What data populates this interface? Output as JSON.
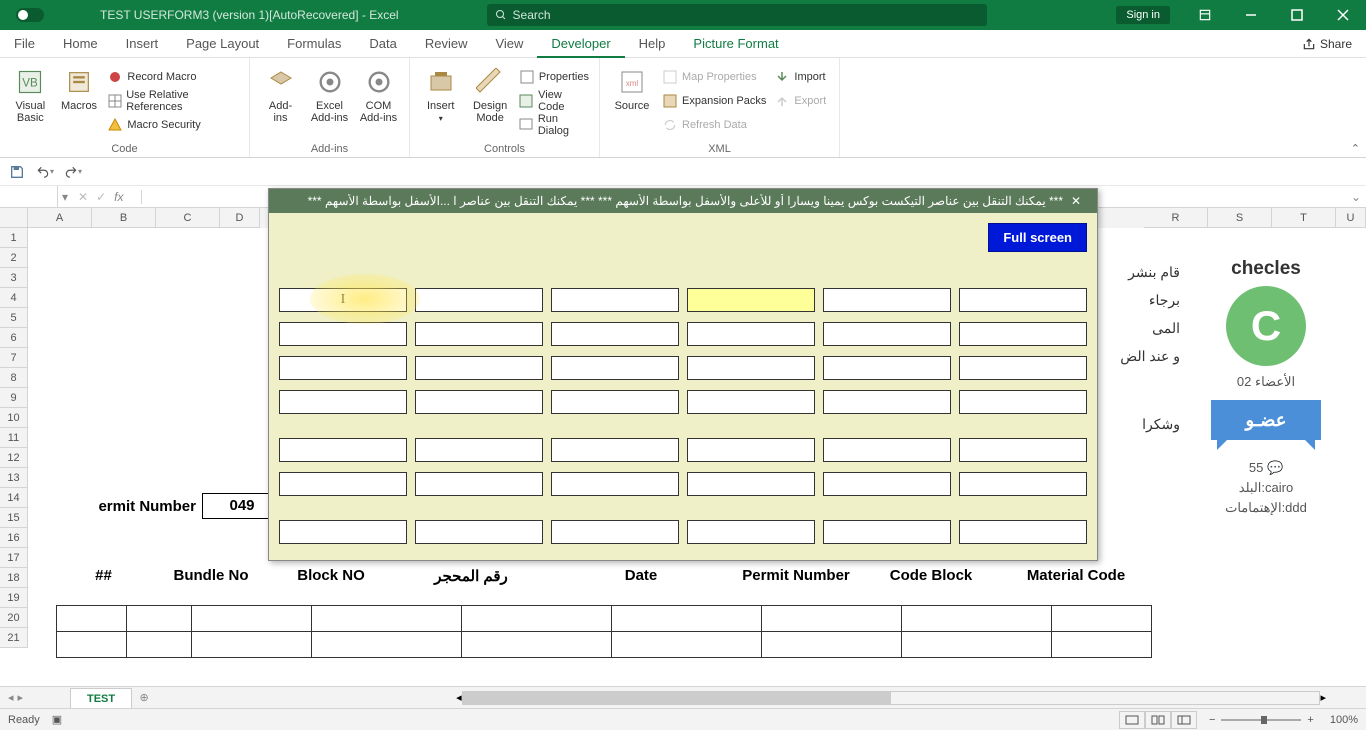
{
  "titlebar": {
    "doc": "TEST USERFORM3 (version 1)[AutoRecovered]  -  Excel",
    "search_placeholder": "Search",
    "signin": "Sign in"
  },
  "tabs": {
    "file": "File",
    "home": "Home",
    "insert": "Insert",
    "pagelayout": "Page Layout",
    "formulas": "Formulas",
    "data": "Data",
    "review": "Review",
    "view": "View",
    "developer": "Developer",
    "help": "Help",
    "pictureformat": "Picture Format",
    "share": "Share"
  },
  "ribbon": {
    "code": {
      "label": "Code",
      "visualbasic": "Visual\nBasic",
      "macros": "Macros",
      "record": "Record Macro",
      "relative": "Use Relative References",
      "security": "Macro Security"
    },
    "addins": {
      "label": "Add-ins",
      "addins": "Add-\nins",
      "excel": "Excel\nAdd-ins",
      "com": "COM\nAdd-ins"
    },
    "controls": {
      "label": "Controls",
      "insert": "Insert",
      "design": "Design\nMode",
      "properties": "Properties",
      "viewcode": "View Code",
      "rundialog": "Run Dialog"
    },
    "xml": {
      "label": "XML",
      "source": "Source",
      "mapprops": "Map Properties",
      "expansion": "Expansion Packs",
      "refresh": "Refresh Data",
      "import": "Import",
      "export": "Export"
    }
  },
  "namebox": "",
  "worksheet": {
    "permit_label": "ermit Number",
    "permit_value": "049",
    "headers": {
      "h1": "##",
      "h2": "Bundle No",
      "h3": "Block NO",
      "h4": "رقم المحجر",
      "h5": "Date",
      "h6": "Permit Number",
      "h7": "Code Block",
      "h8": "Material Code"
    }
  },
  "side": {
    "t1": "قام بنشر",
    "t2": "برجاء المى",
    "t3": "و عند الض",
    "t4": "وشكرا"
  },
  "profile": {
    "name": "checles",
    "initial": "C",
    "members": "الأعضاء 02",
    "badge": "عضـو",
    "posts": "55",
    "country": "البلد:cairo",
    "interests": "الإهتمامات:ddd"
  },
  "userform": {
    "title": "*** يمكنك التنقل بين عناصر التيكست بوكس يمينا ويسارا أو للأعلى والأسفل بواسطة الأسهم ***  *** يمكنك التنقل بين عناصر ا         ...الأسفل بواسطة الأسهم ***",
    "fullscreen": "Full screen"
  },
  "sheet": {
    "name": "TEST"
  },
  "status": {
    "ready": "Ready",
    "zoom": "100%"
  },
  "cols": [
    "A",
    "B",
    "C",
    "D",
    "",
    "",
    "",
    "",
    "",
    "",
    "",
    "",
    "",
    "",
    "",
    "",
    "",
    "R",
    "S",
    "T",
    "U"
  ]
}
